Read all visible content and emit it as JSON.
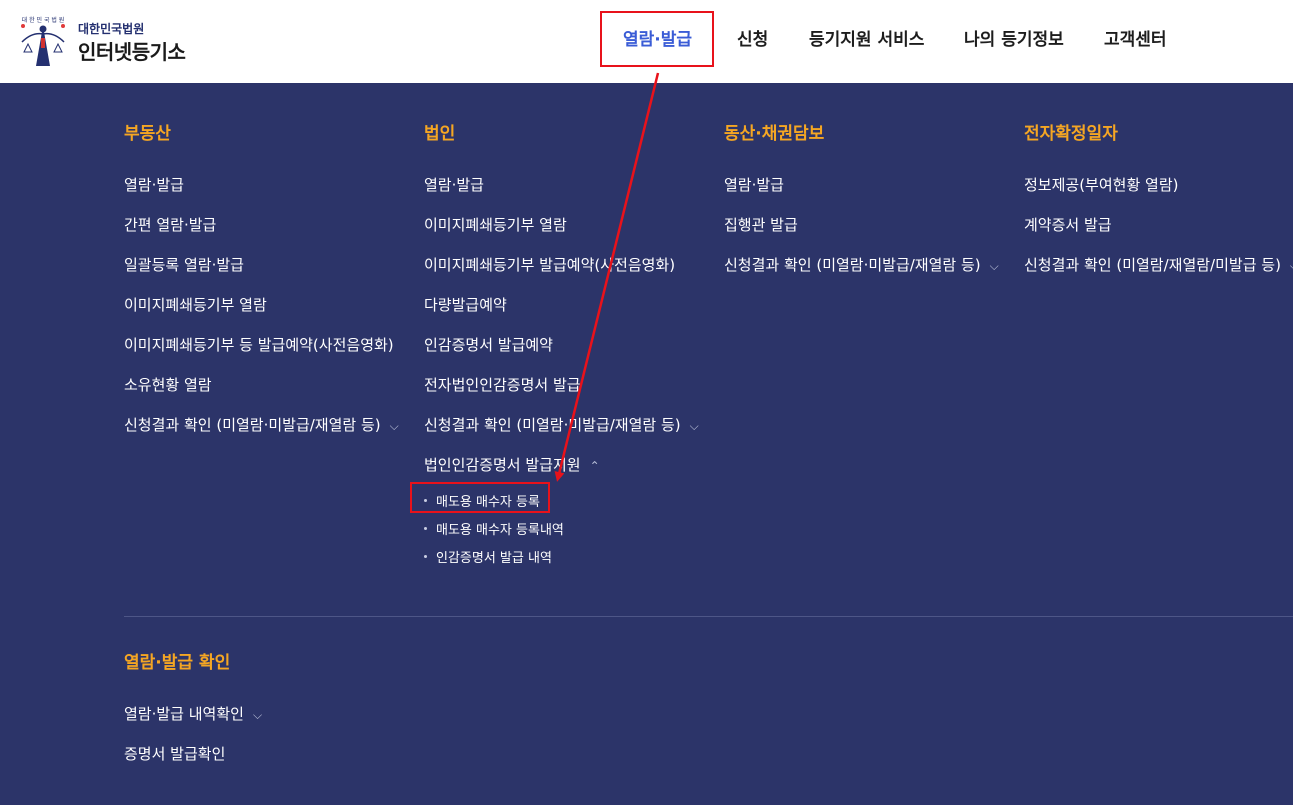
{
  "header": {
    "logo": {
      "court_name": "대한민국법원",
      "site_name": "인터넷등기소",
      "emblem_text": "대 한 민 국 법 원"
    },
    "gnb": [
      {
        "label": "열람·발급",
        "active": true
      },
      {
        "label": "신청",
        "active": false
      },
      {
        "label": "등기지원 서비스",
        "active": false
      },
      {
        "label": "나의 등기정보",
        "active": false
      },
      {
        "label": "고객센터",
        "active": false
      }
    ]
  },
  "megamenu": {
    "columns": [
      {
        "title": "부동산",
        "items": [
          {
            "label": "열람·발급"
          },
          {
            "label": "간편 열람·발급"
          },
          {
            "label": "일괄등록 열람·발급"
          },
          {
            "label": "이미지폐쇄등기부 열람"
          },
          {
            "label": "이미지폐쇄등기부 등 발급예약(사전음영화)"
          },
          {
            "label": "소유현황 열람"
          },
          {
            "label": "신청결과 확인 (미열람·미발급/재열람 등)",
            "chevron": "down"
          }
        ]
      },
      {
        "title": "법인",
        "items": [
          {
            "label": "열람·발급"
          },
          {
            "label": "이미지폐쇄등기부 열람"
          },
          {
            "label": "이미지폐쇄등기부 발급예약(사전음영화)"
          },
          {
            "label": "다량발급예약"
          },
          {
            "label": "인감증명서 발급예약"
          },
          {
            "label": "전자법인인감증명서 발급"
          },
          {
            "label": "신청결과 확인 (미열람·미발급/재열람 등)",
            "chevron": "down"
          },
          {
            "label": "법인인감증명서 발급지원",
            "chevron": "up"
          }
        ],
        "subitems": [
          {
            "label": "매도용 매수자 등록"
          },
          {
            "label": "매도용 매수자 등록내역"
          },
          {
            "label": "인감증명서 발급 내역"
          }
        ]
      },
      {
        "title": "동산·채권담보",
        "items": [
          {
            "label": "열람·발급"
          },
          {
            "label": "집행관 발급"
          },
          {
            "label": "신청결과 확인 (미열람·미발급/재열람 등)",
            "chevron": "down"
          }
        ]
      },
      {
        "title": "전자확정일자",
        "items": [
          {
            "label": "정보제공(부여현황 열람)"
          },
          {
            "label": "계약증서 발급"
          },
          {
            "label": "신청결과 확인 (미열람/재열람/미발급 등)",
            "chevron": "down"
          }
        ]
      }
    ],
    "confirm_section": {
      "title": "열람·발급 확인",
      "items": [
        {
          "label": "열람·발급 내역확인",
          "chevron": "down"
        },
        {
          "label": "증명서 발급확인"
        }
      ]
    }
  },
  "icons": {
    "chevron_down": "⌵",
    "chevron_up": "⌃"
  },
  "colors": {
    "header_bg": "#ffffff",
    "menu_bg": "#2c3469",
    "section_title": "#f5a623",
    "active_nav": "#3a5cd6",
    "annotation_red": "#e8121b"
  }
}
